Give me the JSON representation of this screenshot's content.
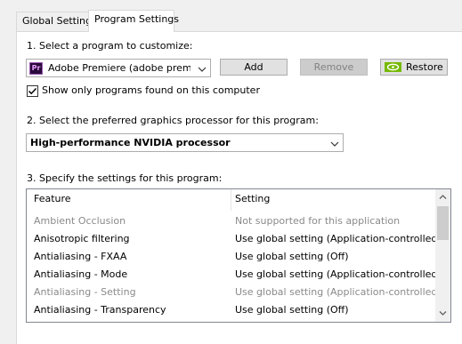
{
  "tabs": [
    {
      "label": "Global Settings"
    },
    {
      "label": "Program Settings"
    }
  ],
  "step1": {
    "label": "1. Select a program to customize:",
    "program_combo_value": "Adobe Premiere (adobe premier…",
    "program_icon_text": "Pr",
    "add_label": "Add",
    "remove_label": "Remove",
    "restore_label": "Restore",
    "show_only_label": "Show only programs found on this computer",
    "show_only_checked": true
  },
  "step2": {
    "label": "2. Select the preferred graphics processor for this program:",
    "processor_value": "High-performance NVIDIA processor"
  },
  "step3": {
    "label": "3. Specify the settings for this program:",
    "col_feature": "Feature",
    "col_setting": "Setting",
    "rows": [
      {
        "feature": "Ambient Occlusion",
        "setting": "Not supported for this application",
        "disabled": true
      },
      {
        "feature": "Anisotropic filtering",
        "setting": "Use global setting (Application-controlled)",
        "disabled": false
      },
      {
        "feature": "Antialiasing - FXAA",
        "setting": "Use global setting (Off)",
        "disabled": false
      },
      {
        "feature": "Antialiasing - Mode",
        "setting": "Use global setting (Application-controlled)",
        "disabled": false
      },
      {
        "feature": "Antialiasing - Setting",
        "setting": "Use global setting (Application-controlled)",
        "disabled": true
      },
      {
        "feature": "Antialiasing - Transparency",
        "setting": "Use global setting (Off)",
        "disabled": false
      }
    ]
  },
  "colors": {
    "premiere_icon_bg": "#2a0a3a",
    "premiere_icon_fg": "#e8a0ff",
    "nvidia_green": "#76b900",
    "disabled_text": "#8a8a8a"
  }
}
